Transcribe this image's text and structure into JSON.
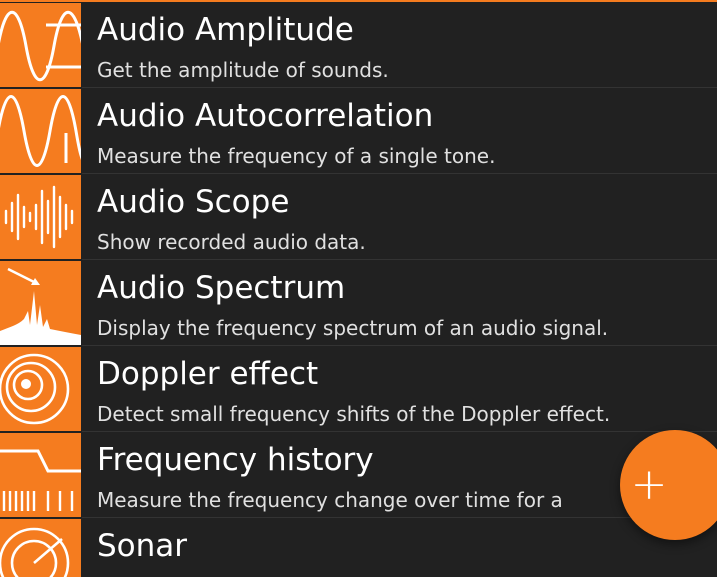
{
  "theme": {
    "accent": "#f57c1f",
    "background": "#212121",
    "text": "#ffffff"
  },
  "experiments": [
    {
      "title": "Audio Amplitude",
      "description": "Get the amplitude of sounds.",
      "icon": "sine-wave-amplitude-icon"
    },
    {
      "title": "Audio Autocorrelation",
      "description": "Measure the frequency of a single tone.",
      "icon": "sine-wave-icon"
    },
    {
      "title": "Audio Scope",
      "description": "Show recorded audio data.",
      "icon": "waveform-bars-icon"
    },
    {
      "title": "Audio Spectrum",
      "description": "Display the frequency spectrum of an audio signal.",
      "icon": "spectrum-icon"
    },
    {
      "title": "Doppler effect",
      "description": "Detect small frequency shifts of the Doppler effect.",
      "icon": "concentric-circles-icon"
    },
    {
      "title": "Frequency history",
      "description": "Measure the frequency change over time for a",
      "icon": "frequency-step-icon"
    },
    {
      "title": "Sonar",
      "description": "",
      "icon": "sonar-icon"
    }
  ],
  "fab": {
    "label": "+",
    "icon": "plus-icon"
  }
}
